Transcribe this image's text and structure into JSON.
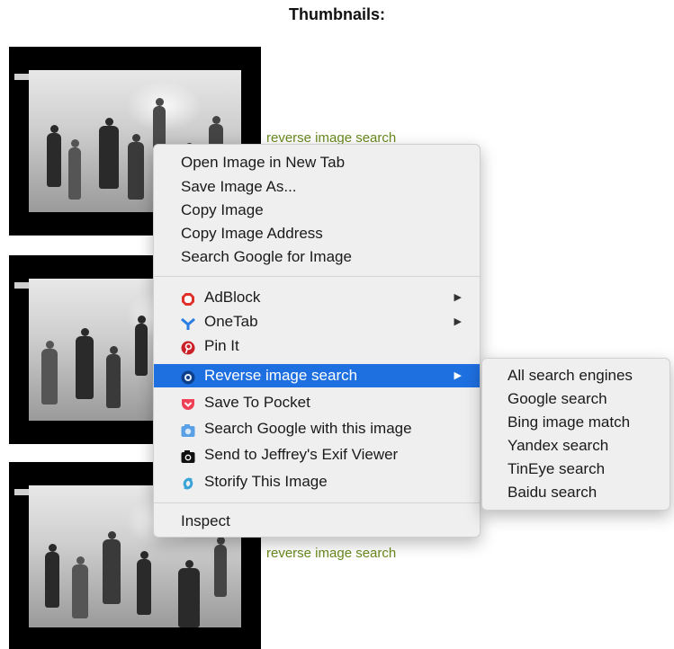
{
  "page": {
    "title": "Thumbnails:",
    "thumb_links": [
      "reverse image search",
      "reverse image search"
    ]
  },
  "context_menu": {
    "group1": [
      "Open Image in New Tab",
      "Save Image As...",
      "Copy Image",
      "Copy Image Address",
      "Search Google for Image"
    ],
    "group2": [
      {
        "label": "AdBlock",
        "icon": "adblock-icon",
        "has_submenu": true
      },
      {
        "label": "OneTab",
        "icon": "onetab-icon",
        "has_submenu": true
      },
      {
        "label": "Pin It",
        "icon": "pinterest-icon",
        "has_submenu": false
      },
      {
        "label": "Reverse image search",
        "icon": "reverse-search-icon",
        "has_submenu": true,
        "highlighted": true
      },
      {
        "label": "Save To Pocket",
        "icon": "pocket-icon",
        "has_submenu": false
      },
      {
        "label": "Search Google with this image",
        "icon": "camera-blue-icon",
        "has_submenu": false
      },
      {
        "label": "Send to Jeffrey's Exif Viewer",
        "icon": "camera-black-icon",
        "has_submenu": false
      },
      {
        "label": "Storify This Image",
        "icon": "storify-icon",
        "has_submenu": false
      }
    ],
    "group3": [
      "Inspect"
    ],
    "submenu_arrow": "▶"
  },
  "submenu": {
    "items": [
      "All search engines",
      "Google search",
      "Bing image match",
      "Yandex search",
      "TinEye search",
      "Baidu search"
    ]
  },
  "colors": {
    "highlight": "#1e6fe0",
    "link": "#6a8a1e",
    "menu_bg": "#efefef"
  }
}
